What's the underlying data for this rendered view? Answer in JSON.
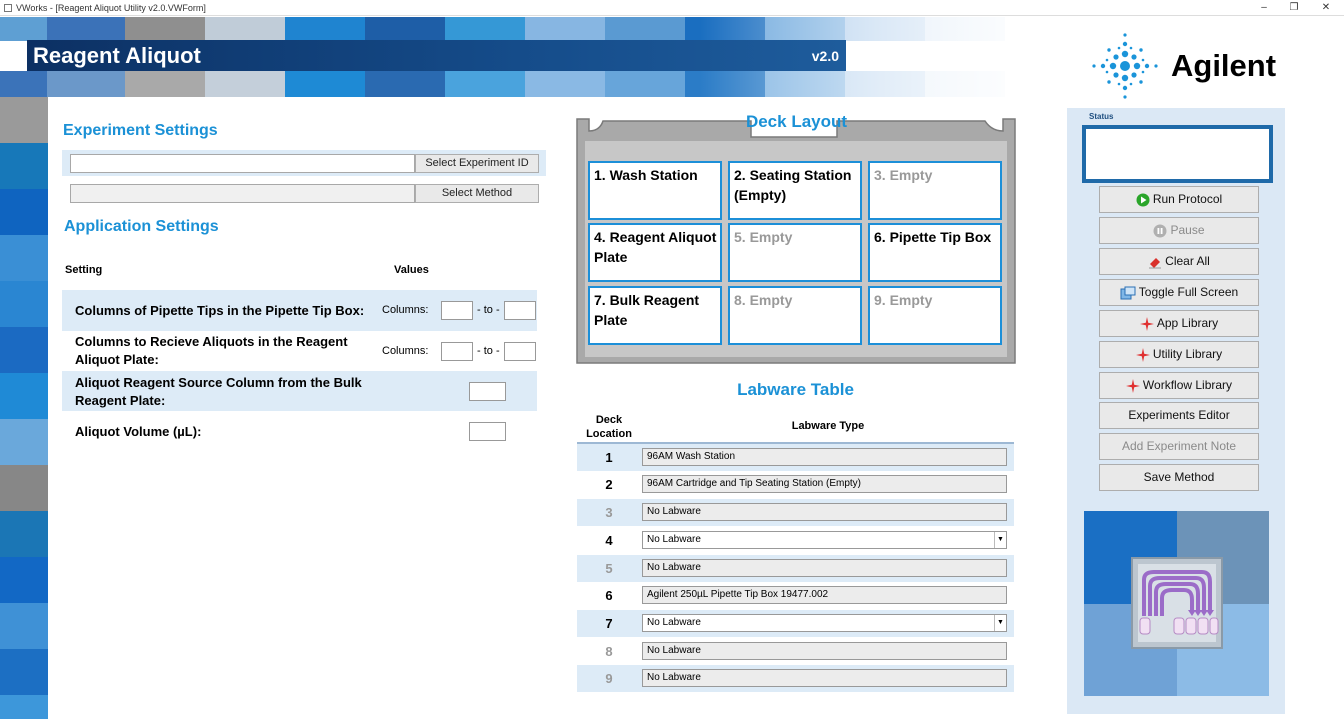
{
  "window": {
    "title": "VWorks - [Reagent Aliquot Utility v2.0.VWForm]",
    "minimize": "–",
    "restore": "❐",
    "close": "✕"
  },
  "banner": {
    "title": "Reagent Aliquot",
    "version": "v2.0"
  },
  "logo": {
    "text": "Agilent"
  },
  "experiment_settings": {
    "heading": "Experiment Settings",
    "experiment_id_value": "",
    "select_experiment_label": "Select Experiment ID",
    "method_value": "",
    "select_method_label": "Select Method"
  },
  "application_settings": {
    "heading": "Application Settings",
    "col_setting": "Setting",
    "col_values": "Values",
    "rows": [
      {
        "label": "Columns of Pipette Tips in the Pipette Tip Box:",
        "prefix": "Columns:",
        "to": "- to -"
      },
      {
        "label": "Columns to Recieve Aliquots in the Reagent Aliquot Plate:",
        "prefix": "Columns:",
        "to": "- to -"
      },
      {
        "label": "Aliquot Reagent Source Column from the Bulk Reagent Plate:"
      },
      {
        "label": "Aliquot Volume (µL):"
      }
    ]
  },
  "deck_layout": {
    "heading": "Deck Layout",
    "cells": [
      "1. Wash Station",
      "2. Seating Station (Empty)",
      "3. Empty",
      "4. Reagent Aliquot Plate",
      "5. Empty",
      "6. Pipette Tip Box",
      "7. Bulk Reagent Plate",
      "8. Empty",
      "9. Empty"
    ]
  },
  "labware_table": {
    "heading": "Labware Table",
    "col_location": "Deck Location",
    "col_type": "Labware Type",
    "rows": [
      {
        "loc": "1",
        "type": "96AM Wash Station"
      },
      {
        "loc": "2",
        "type": "96AM Cartridge and Tip Seating Station (Empty)"
      },
      {
        "loc": "3",
        "type": "No Labware"
      },
      {
        "loc": "4",
        "type": "No Labware"
      },
      {
        "loc": "5",
        "type": "No Labware"
      },
      {
        "loc": "6",
        "type": "Agilent 250µL Pipette Tip Box 19477.002"
      },
      {
        "loc": "7",
        "type": "No Labware"
      },
      {
        "loc": "8",
        "type": "No Labware"
      },
      {
        "loc": "9",
        "type": "No Labware"
      }
    ]
  },
  "status": {
    "label": "Status",
    "text": ""
  },
  "buttons": {
    "run_protocol": "Run Protocol",
    "pause": "Pause",
    "clear_all": "Clear All",
    "toggle_full_screen": "Toggle Full Screen",
    "app_library": "App Library",
    "utility_library": "Utility Library",
    "workflow_library": "Workflow Library",
    "experiments_editor": "Experiments Editor",
    "add_experiment_note": "Add Experiment Note",
    "save_method": "Save Method"
  },
  "colors": {
    "accent_blue": "#1b91d6",
    "banner_navy": "#0c3063",
    "panel_bg": "#dbe8f5",
    "deck_border": "#1c8fd8"
  }
}
